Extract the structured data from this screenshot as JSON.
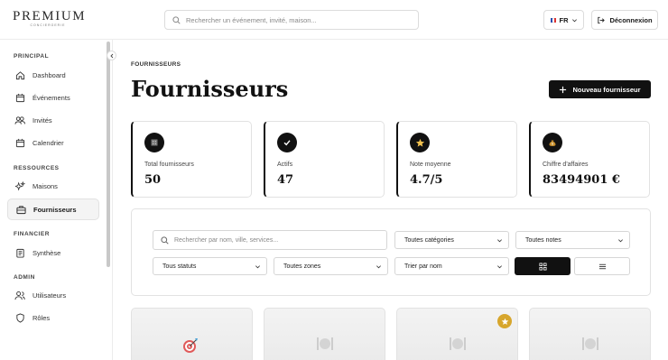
{
  "brand": {
    "name": "PREMIUM",
    "tagline": "CONCIERGERIE"
  },
  "header": {
    "search_placeholder": "Rechercher un événement, invité, maison...",
    "language": "FR",
    "logout_label": "Déconnexion"
  },
  "sidebar": {
    "sections": [
      {
        "title": "PRINCIPAL",
        "items": [
          {
            "label": "Dashboard",
            "icon": "home-icon"
          },
          {
            "label": "Événements",
            "icon": "calendar-icon"
          },
          {
            "label": "Invités",
            "icon": "users-icon"
          },
          {
            "label": "Calendrier",
            "icon": "calendar-icon"
          }
        ]
      },
      {
        "title": "RESSOURCES",
        "items": [
          {
            "label": "Maisons",
            "icon": "sparkle-icon"
          },
          {
            "label": "Fournisseurs",
            "icon": "briefcase-icon",
            "active": true
          }
        ]
      },
      {
        "title": "FINANCIER",
        "items": [
          {
            "label": "Synthèse",
            "icon": "receipt-icon"
          }
        ]
      },
      {
        "title": "ADMIN",
        "items": [
          {
            "label": "Utilisateurs",
            "icon": "user-group-icon"
          },
          {
            "label": "Rôles",
            "icon": "shield-icon"
          }
        ]
      }
    ]
  },
  "page": {
    "breadcrumb": "FOURNISSEURS",
    "title": "Fournisseurs",
    "new_button": "Nouveau fournisseur"
  },
  "stats": [
    {
      "label": "Total fournisseurs",
      "value": "50",
      "icon": "building-icon"
    },
    {
      "label": "Actifs",
      "value": "47",
      "icon": "check-icon"
    },
    {
      "label": "Note moyenne",
      "value": "4.7/5",
      "icon": "star-icon"
    },
    {
      "label": "Chiffre d'affaires",
      "value": "83494901 €",
      "icon": "money-bag-icon"
    }
  ],
  "filters": {
    "search_placeholder": "Rechercher par nom, ville, services...",
    "category": "Toutes catégories",
    "rating": "Toutes notes",
    "status": "Tous statuts",
    "zone": "Toutes zones",
    "sort": "Trier par nom"
  },
  "cards": [
    {
      "icon": "target-icon",
      "featured": false
    },
    {
      "icon": "dining-icon",
      "featured": false
    },
    {
      "icon": "dining-icon",
      "featured": true
    },
    {
      "icon": "dining-icon",
      "featured": false
    }
  ],
  "colors": {
    "primary": "#111111",
    "accent_gold": "#d7a62c",
    "border": "#e2e2e2"
  }
}
